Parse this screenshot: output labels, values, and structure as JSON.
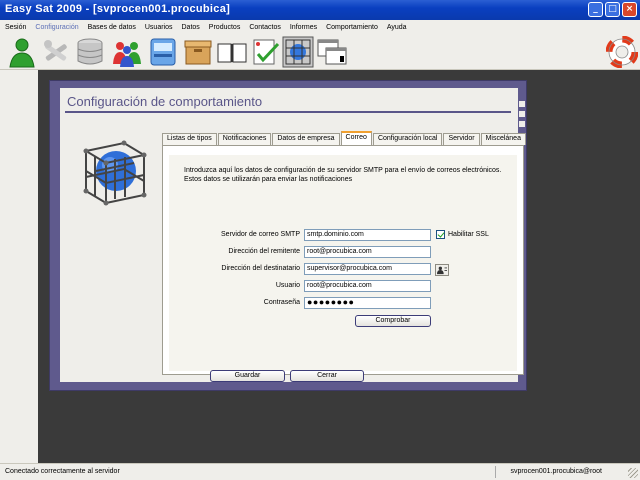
{
  "window": {
    "title": "Easy Sat 2009 - [svprocen001.procubica]"
  },
  "menu": [
    "Sesión",
    "Configuración",
    "Bases de datos",
    "Usuarios",
    "Datos",
    "Productos",
    "Contactos",
    "Informes",
    "Comportamiento",
    "Ayuda"
  ],
  "toolbar": {
    "icons": [
      "user-icon",
      "tools-icon",
      "database-icon",
      "users-group-icon",
      "computer-icon",
      "box-icon",
      "book-icon",
      "checklist-icon",
      "cube-icon",
      "windows-icon"
    ],
    "help_icon": "lifebuoy-icon"
  },
  "dialog": {
    "title": "Configuración de comportamiento",
    "tabs": [
      "Listas de tipos",
      "Notificaciones",
      "Datos de empresa",
      "Correo",
      "Configuración local",
      "Servidor",
      "Miscelánea"
    ],
    "active_tab": "Correo",
    "intro": "Introduzca aquí los datos de configuración de su servidor SMTP para el envío de correos electrónicos. Estos datos se utilizarán para enviar las notificaciones",
    "fields": {
      "smtp_label": "Servidor de correo SMTP",
      "smtp_value": "smtp.dominio.com",
      "sender_label": "Dirección del remitente",
      "sender_value": "root@procubica.com",
      "recipient_label": "Dirección del destinatario",
      "recipient_value": "supervisor@procubica.com",
      "user_label": "Usuario",
      "user_value": "root@procubica.com",
      "password_label": "Contraseña",
      "password_value": "●●●●●●●●"
    },
    "ssl_label": "Habilitar SSL",
    "ssl_checked": true,
    "test_button": "Comprobar",
    "save_button": "Guardar",
    "close_button": "Cerrar"
  },
  "status": {
    "left": "Conectado correctamente al servidor",
    "right": "svprocen001.procubica@root"
  },
  "colors": {
    "titlebar": "#0a3fc0",
    "dialog_frame": "#5f5a8d",
    "title_text": "#5a5689",
    "active_tab": "#f0a030"
  }
}
